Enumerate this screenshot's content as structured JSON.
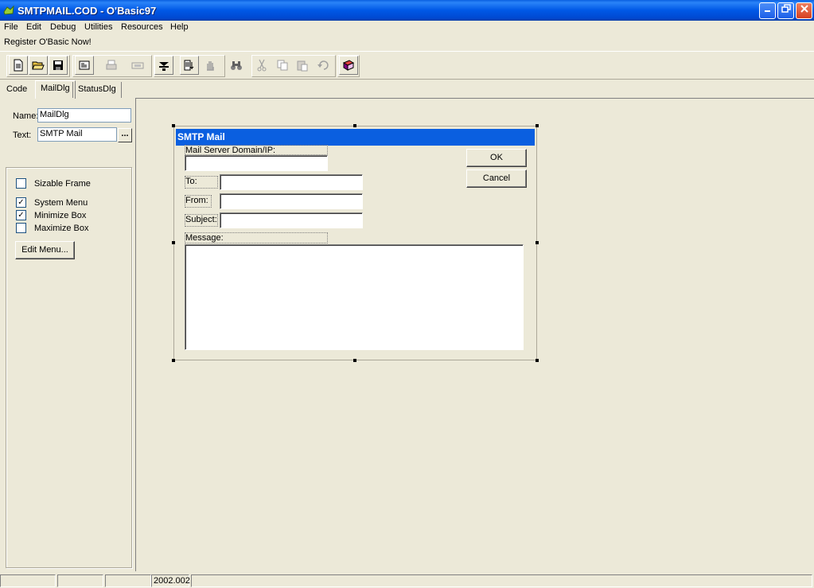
{
  "window": {
    "title": "SMTPMAIL.COD - O'Basic97"
  },
  "menu": [
    "File",
    "Edit",
    "Debug",
    "Utilities",
    "Resources",
    "Help"
  ],
  "register_text": "Register O'Basic Now!",
  "tabs": [
    "Code",
    "MailDlg",
    "StatusDlg"
  ],
  "properties": {
    "name_label": "Name:",
    "name_value": "MailDlg",
    "text_label": "Text:",
    "text_value": "SMTP Mail",
    "ellipsis_label": "...",
    "options": [
      {
        "label": "Sizable Frame",
        "checked": false
      },
      {
        "label": "System Menu",
        "checked": true
      },
      {
        "label": "Minimize Box",
        "checked": true
      },
      {
        "label": "Maximize Box",
        "checked": false
      }
    ],
    "edit_menu_label": "Edit Menu..."
  },
  "dialog": {
    "title": "SMTP Mail",
    "server_label": "Mail Server Domain/IP:",
    "to_label": "To:",
    "from_label": "From:",
    "subject_label": "Subject:",
    "message_label": "Message:",
    "ok_label": "OK",
    "cancel_label": "Cancel"
  },
  "statusbar": {
    "panes": [
      "",
      "",
      "",
      "2002.002"
    ]
  },
  "colors": {
    "titlebar": "#0058e6",
    "face": "#ece9d8",
    "dialog_title": "#0a5fe0"
  }
}
